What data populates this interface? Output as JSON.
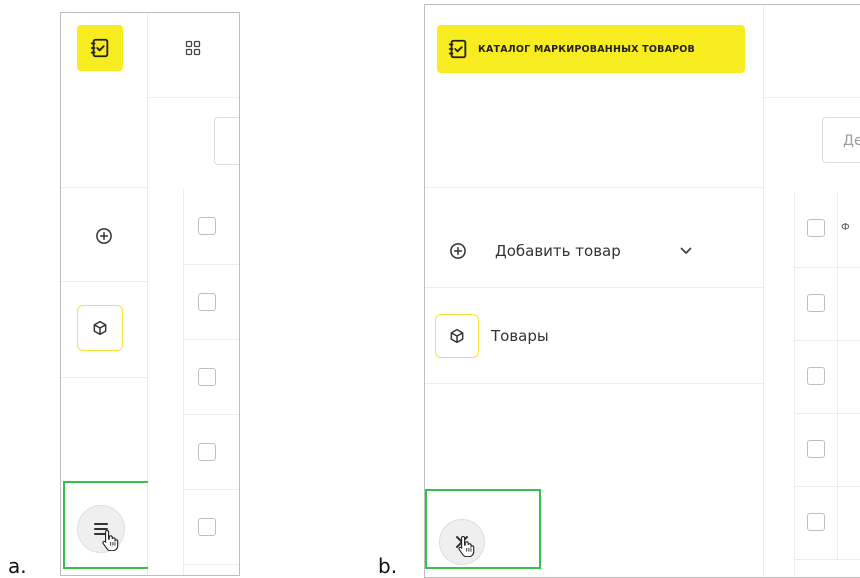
{
  "captions": {
    "a": "a.",
    "b": "b."
  },
  "colors": {
    "brand_yellow": "#f7ec1f",
    "highlight_green": "#35c24a",
    "border_gray": "#ececec",
    "text_dark": "#333333"
  },
  "icons": {
    "logo": "checklist-icon",
    "apps": "grid-icon",
    "add": "plus-circle-icon",
    "products": "cube-icon",
    "expand": "hamburger-menu-icon",
    "collapse": "close-icon",
    "dropdown": "chevron-down-icon",
    "pointer": "hand-pointer-icon"
  },
  "collapsed": {
    "table_rows": 5
  },
  "expanded": {
    "logo_text": "КАТАЛОГ МАРКИРОВАННЫХ ТОВАРОВ",
    "filter_placeholder": "Де",
    "column_header": "Ф",
    "menu": {
      "add_product": "Добавить товар",
      "products": "Товары"
    },
    "table_rows": 5
  }
}
